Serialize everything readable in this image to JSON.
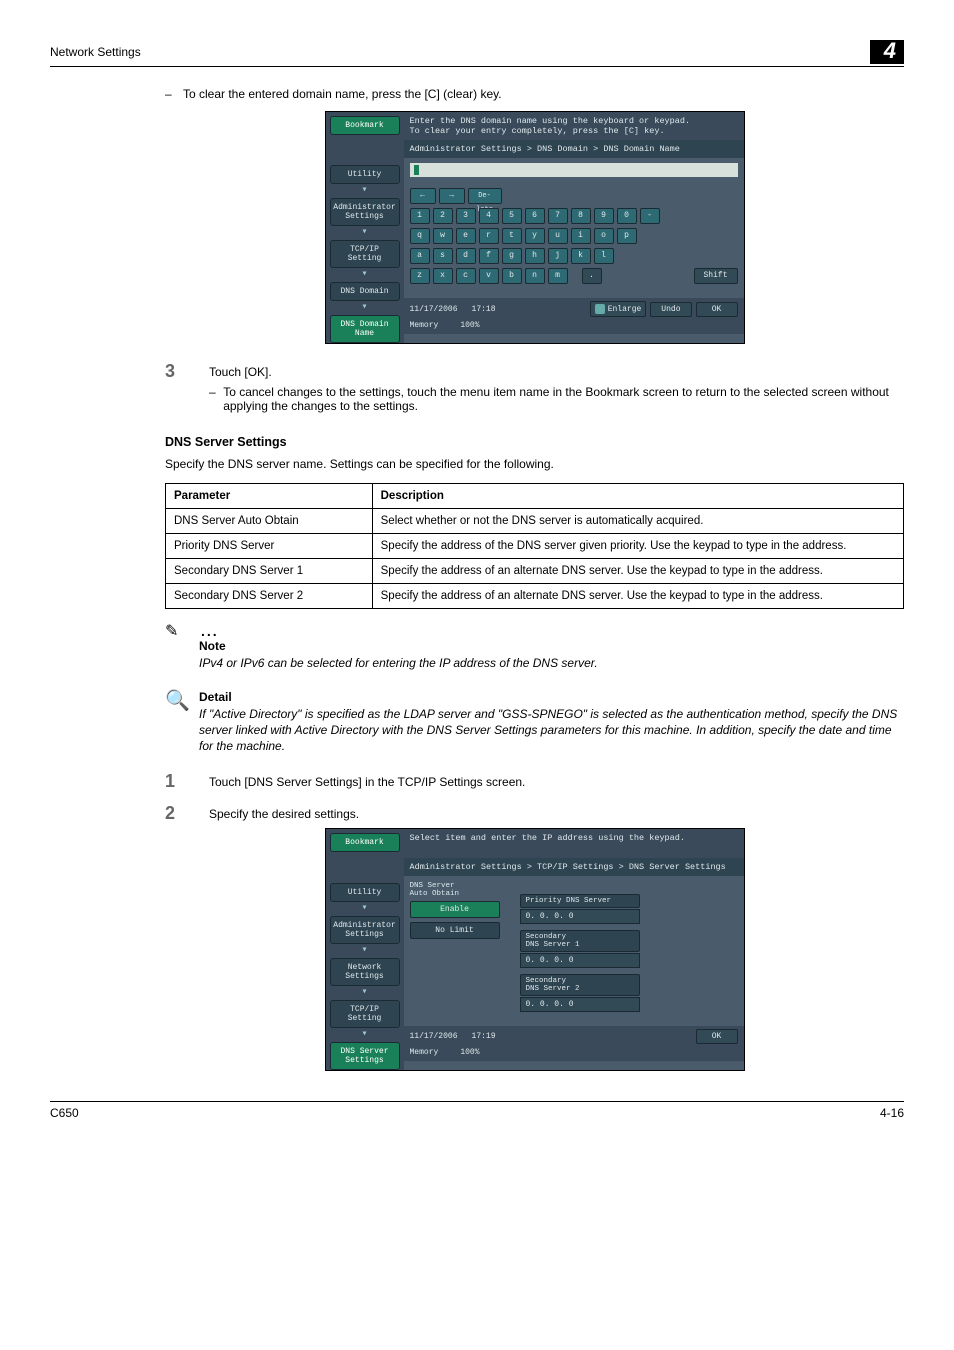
{
  "header": {
    "title": "Network Settings",
    "chapter": "4"
  },
  "intro_bullet": "To clear the entered domain name, press the [C] (clear) key.",
  "screen1": {
    "top_line1": "Enter the DNS domain name using the keyboard or keypad.",
    "top_line2": "To clear your entry completely, press the [C] key.",
    "breadcrumb": "Administrator Settings > DNS Domain > DNS Domain Name",
    "side": {
      "bookmark": "Bookmark",
      "items": [
        "Utility",
        "Administrator Settings",
        "TCP/IP Setting",
        "DNS Domain",
        "DNS Domain Name"
      ]
    },
    "arrow_left": "←",
    "arrow_right": "→",
    "delete": "De-\nlete",
    "row1": [
      "1",
      "2",
      "3",
      "4",
      "5",
      "6",
      "7",
      "8",
      "9",
      "0",
      "-"
    ],
    "row2": [
      "q",
      "w",
      "e",
      "r",
      "t",
      "y",
      "u",
      "i",
      "o",
      "p"
    ],
    "row3": [
      "a",
      "s",
      "d",
      "f",
      "g",
      "h",
      "j",
      "k",
      "l"
    ],
    "row4": [
      "z",
      "x",
      "c",
      "v",
      "b",
      "n",
      "m"
    ],
    "space": ".",
    "shift": "Shift",
    "enlarge": "Enlarge",
    "undo": "Undo",
    "ok": "OK",
    "foot_date": "11/17/2006",
    "foot_time": "17:18",
    "foot_mem": "Memory",
    "foot_pct": "100%"
  },
  "step3": {
    "num": "3",
    "text": "Touch [OK].",
    "sub": "To cancel changes to the settings, touch the menu item name in the Bookmark screen to return to the selected screen without applying the changes to the settings."
  },
  "dns_section": {
    "heading": "DNS Server Settings",
    "intro": "Specify the DNS server name. Settings can be specified for the following.",
    "th_param": "Parameter",
    "th_desc": "Description",
    "rows": [
      {
        "p": "DNS Server Auto Obtain",
        "d": "Select whether or not the DNS server is automatically acquired."
      },
      {
        "p": "Priority DNS Server",
        "d": "Specify the address of the DNS server given priority. Use the keypad to type in the address."
      },
      {
        "p": "Secondary DNS Server 1",
        "d": "Specify the address of an alternate DNS server. Use the keypad to type in the address."
      },
      {
        "p": "Secondary DNS Server 2",
        "d": "Specify the address of an alternate DNS server. Use the keypad to type in the address."
      }
    ]
  },
  "note1": {
    "title": "Note",
    "text": "IPv4 or IPv6 can be selected for entering the IP address of the DNS server."
  },
  "note2": {
    "title": "Detail",
    "text": "If \"Active Directory\" is specified as the LDAP server and \"GSS-SPNEGO\" is selected as the authentication method, specify the DNS server linked with Active Directory with the DNS Server Settings parameters for this machine. In addition, specify the date and time for the machine."
  },
  "step1b": {
    "num": "1",
    "text": "Touch [DNS Server Settings] in the TCP/IP Settings screen."
  },
  "step2b": {
    "num": "2",
    "text": "Specify the desired settings."
  },
  "screen2": {
    "top_line1": "Select item and enter the IP address using the keypad.",
    "breadcrumb": "Administrator Settings > TCP/IP Settings > DNS Server Settings",
    "side": {
      "bookmark": "Bookmark",
      "items": [
        "Utility",
        "Administrator Settings",
        "Network Settings",
        "TCP/IP Setting",
        "DNS Server Settings"
      ]
    },
    "auto_label": "DNS Server\nAuto Obtain",
    "enable": "Enable",
    "nolimit": "No Limit",
    "priority_lbl": "Priority DNS Server",
    "priority_val": "0. 0. 0. 0",
    "sec1_lbl": "Secondary\nDNS Server 1",
    "sec1_val": "0. 0. 0. 0",
    "sec2_lbl": "Secondary\nDNS Server 2",
    "sec2_val": "0. 0. 0. 0",
    "ok": "OK",
    "foot_date": "11/17/2006",
    "foot_time": "17:19",
    "foot_mem": "Memory",
    "foot_pct": "100%"
  },
  "footer": {
    "left": "C650",
    "right": "4-16"
  }
}
